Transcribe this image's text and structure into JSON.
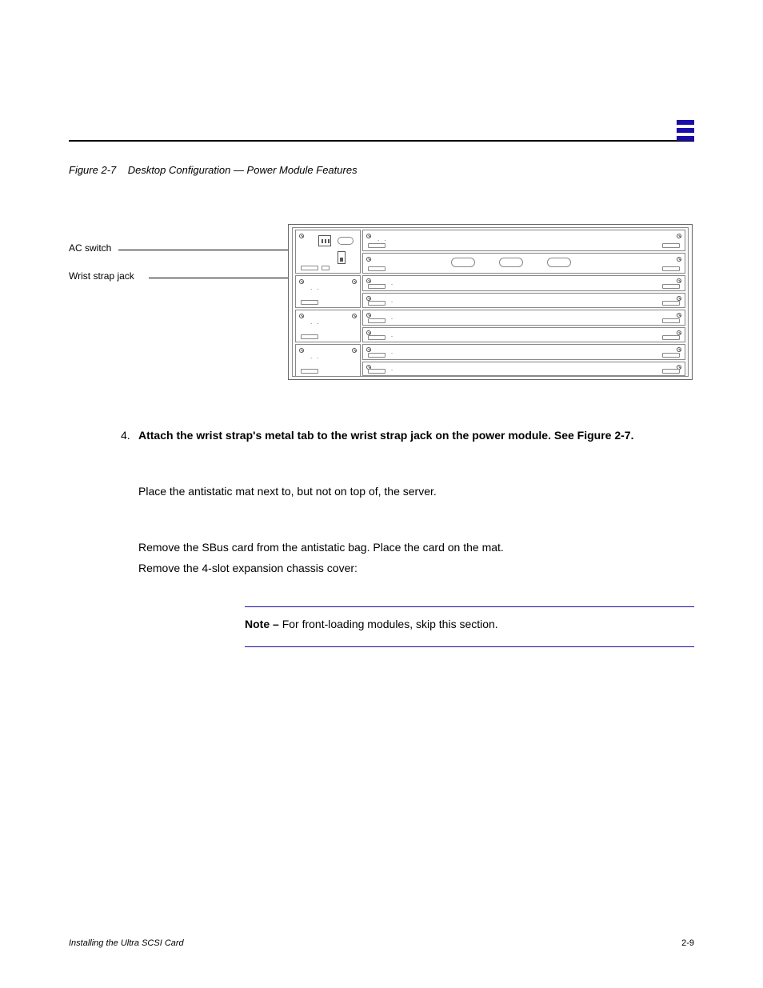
{
  "header": {},
  "figure2": {
    "label": "Figure 2-7",
    "caption": "Desktop Configuration — Power Module Features"
  },
  "diagram": {
    "callout1": "AC switch",
    "callout2": "Wrist strap jack"
  },
  "instructions": {
    "s4_number": "4.",
    "s4_textA": "Attach the wrist strap's metal tab to the wrist strap jack on the power module.",
    "s4_textB": "See Figure 2-7.",
    "s5_text": "Place the antistatic mat next to, but not on top of, the server.",
    "s6_text": "Remove the SBus card from the antistatic bag. Place the card on the mat.",
    "s7_text": "Remove the 4-slot expansion chassis cover:"
  },
  "note": {
    "label": "Note –",
    "text": "For front-loading modules, skip this section."
  },
  "footer": {
    "chapter": "Installing the Ultra SCSI Card",
    "page": "2-9"
  }
}
